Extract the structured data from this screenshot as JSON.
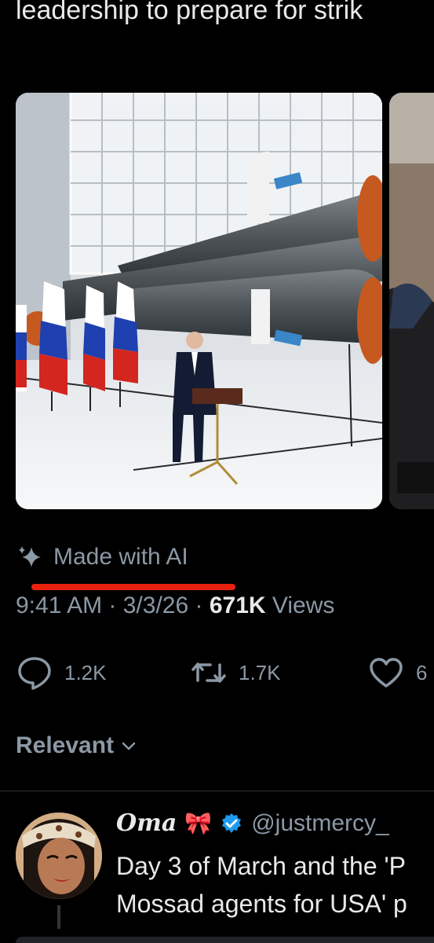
{
  "tweet": {
    "text_line_2": "leadership to prepare for strik"
  },
  "ai_label": {
    "text": "Made with AI",
    "icon": "sparkle-icon",
    "underline_color": "#e8210f"
  },
  "meta": {
    "time": "9:41 AM",
    "sep1": " · ",
    "date": "3/3/26",
    "sep2": " · ",
    "views_count": "671K",
    "views_label": " Views"
  },
  "actions": {
    "replies": "1.2K",
    "reposts": "1.7K",
    "likes": "6"
  },
  "sort": {
    "label": "Relevant"
  },
  "reply": {
    "name": "Oma",
    "emoji": "🎀",
    "handle": "@justmercy_",
    "line1": "Day 3 of March and the 'P",
    "line2": "Mossad agents for USA' p"
  },
  "colors": {
    "background": "#000000",
    "text": "#e7e9ea",
    "muted": "#8b98a5",
    "verified": "#1d9bf0"
  }
}
